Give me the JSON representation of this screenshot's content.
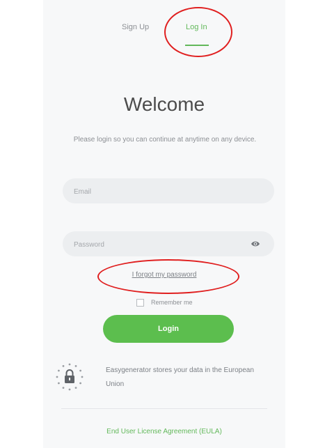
{
  "tabs": {
    "signup": "Sign Up",
    "login": "Log In"
  },
  "welcome": {
    "title": "Welcome",
    "subtitle": "Please login so you can continue at anytime on any device."
  },
  "form": {
    "email_placeholder": "Email",
    "password_placeholder": "Password",
    "forgot_link": "I forgot my password",
    "remember_label": "Remember me",
    "login_button": "Login"
  },
  "footer": {
    "data_notice": "Easygenerator stores your data in the European Union",
    "eula_link": "End User License Agreement (EULA)"
  },
  "icons": {
    "password_toggle": "eye-icon",
    "data_location": "eu-lock-icon"
  },
  "colors": {
    "accent": "#62b85a",
    "button": "#5cbe4e",
    "annotation": "#e01f1f"
  }
}
